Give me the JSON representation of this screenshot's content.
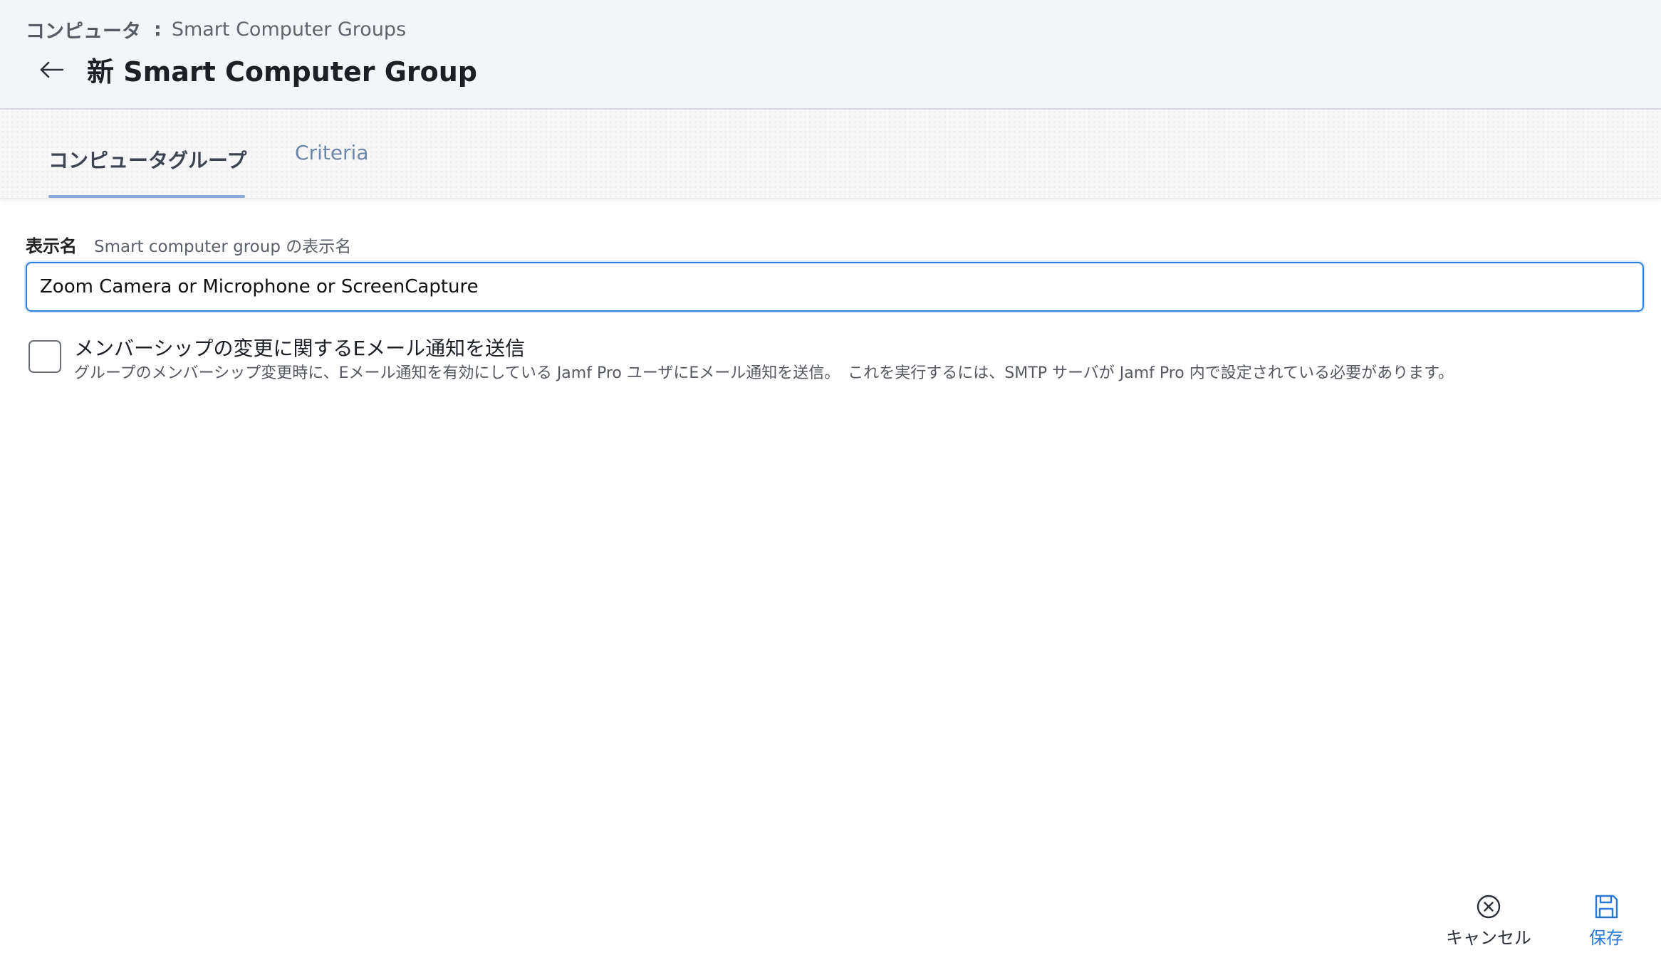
{
  "breadcrumb": {
    "root": "コンピュータ",
    "separator": ":",
    "current": "Smart Computer Groups"
  },
  "header": {
    "back_icon": "arrow-left-icon",
    "title": "新 Smart Computer Group"
  },
  "tabs": [
    {
      "label": "コンピュータグループ",
      "active": true
    },
    {
      "label": "Criteria",
      "active": false
    }
  ],
  "form": {
    "display_name": {
      "label": "表示名",
      "hint": "Smart computer group の表示名",
      "value": "Zoom Camera or Microphone or ScreenCapture"
    },
    "email_notify": {
      "checked": false,
      "title": "メンバーシップの変更に関するEメール通知を送信",
      "description": "グループのメンバーシップ変更時に、Eメール通知を有効にしている Jamf Pro ユーザにEメール通知を送信。　これを実行するには、SMTP サーバが Jamf Pro 内で設定されている必要があります。"
    }
  },
  "footer": {
    "cancel": {
      "label": "キャンセル",
      "icon": "close-circle-icon"
    },
    "save": {
      "label": "保存",
      "icon": "floppy-disk-icon"
    }
  },
  "colors": {
    "accent": "#2a78d4",
    "input_focus": "#2f7fe0",
    "tab_underline": "#8aa9d6",
    "header_bg": "#f4f5f8"
  }
}
